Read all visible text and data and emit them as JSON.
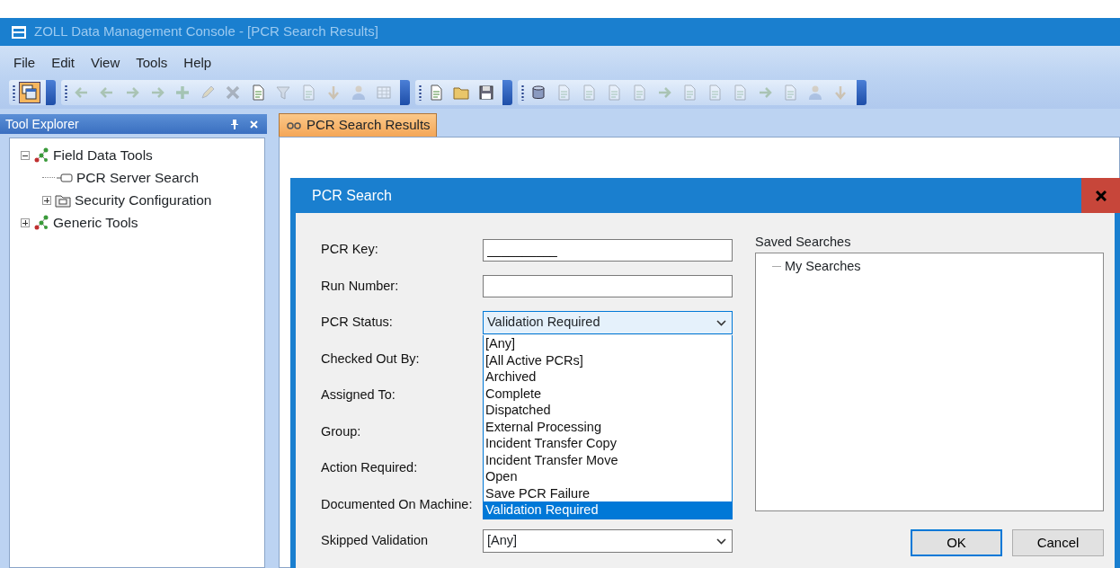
{
  "window": {
    "title": "ZOLL Data Management Console - [PCR Search Results]",
    "active": false
  },
  "menu": [
    {
      "label": "File"
    },
    {
      "label": "Edit"
    },
    {
      "label": "View"
    },
    {
      "label": "Tools"
    },
    {
      "label": "Help"
    }
  ],
  "toolbars": [
    {
      "items": [
        {
          "kind": "windows",
          "disabled": false,
          "selected": true
        }
      ]
    },
    {
      "items": [
        {
          "kind": "arrow-left",
          "disabled": true,
          "selected": false
        },
        {
          "kind": "arrow-left",
          "disabled": true,
          "selected": false
        },
        {
          "kind": "arrow-right",
          "disabled": true,
          "selected": false
        },
        {
          "kind": "arrow-right",
          "disabled": true,
          "selected": false
        },
        {
          "kind": "plus",
          "disabled": true,
          "selected": false
        },
        {
          "kind": "pencil",
          "disabled": true,
          "selected": false
        },
        {
          "kind": "cross",
          "disabled": true,
          "selected": false
        },
        {
          "kind": "page",
          "disabled": false,
          "selected": false
        },
        {
          "kind": "funnel",
          "disabled": true,
          "selected": false
        },
        {
          "kind": "page",
          "disabled": true,
          "selected": false
        },
        {
          "kind": "arrow-down",
          "disabled": true,
          "selected": false
        },
        {
          "kind": "person",
          "disabled": true,
          "selected": false
        },
        {
          "kind": "grid",
          "disabled": true,
          "selected": false
        }
      ]
    },
    {
      "items": [
        {
          "kind": "page",
          "disabled": false,
          "selected": false
        },
        {
          "kind": "folder",
          "disabled": false,
          "selected": false
        },
        {
          "kind": "disk",
          "disabled": false,
          "selected": false
        }
      ]
    },
    {
      "items": [
        {
          "kind": "cylinder",
          "disabled": false,
          "selected": false
        },
        {
          "kind": "page",
          "disabled": true,
          "selected": false
        },
        {
          "kind": "page",
          "disabled": true,
          "selected": false
        },
        {
          "kind": "page",
          "disabled": true,
          "selected": false
        },
        {
          "kind": "page",
          "disabled": true,
          "selected": false
        },
        {
          "kind": "arrow-right",
          "disabled": true,
          "selected": false
        },
        {
          "kind": "page",
          "disabled": true,
          "selected": false
        },
        {
          "kind": "page",
          "disabled": true,
          "selected": false
        },
        {
          "kind": "page",
          "disabled": true,
          "selected": false
        },
        {
          "kind": "arrow-right",
          "disabled": true,
          "selected": false
        },
        {
          "kind": "page",
          "disabled": true,
          "selected": false
        },
        {
          "kind": "person",
          "disabled": true,
          "selected": false
        },
        {
          "kind": "arrow-down",
          "disabled": true,
          "selected": false
        }
      ]
    }
  ],
  "tool_explorer": {
    "title": "Tool Explorer",
    "tree": [
      {
        "label": "Field Data Tools",
        "kind": "network",
        "expanded": true,
        "children": [
          {
            "label": "PCR Server Search",
            "kind": "form"
          },
          {
            "label": "Security Configuration",
            "kind": "folder",
            "expanded": false
          }
        ]
      },
      {
        "label": "Generic Tools",
        "kind": "network",
        "expanded": false
      }
    ]
  },
  "tabs": [
    {
      "label": "PCR Search Results",
      "selected": true
    }
  ],
  "dialog": {
    "title": "PCR Search",
    "fields": [
      {
        "label": "PCR Key:",
        "kind": "text",
        "value": "__________"
      },
      {
        "label": "Run Number:",
        "kind": "text"
      },
      {
        "label": "PCR Status:",
        "kind": "combo",
        "value": "Validation Required",
        "open": true,
        "options": [
          {
            "label": "[Any]",
            "selected": false
          },
          {
            "label": "[All Active PCRs]",
            "selected": false
          },
          {
            "label": "Archived",
            "selected": false
          },
          {
            "label": "Complete",
            "selected": false
          },
          {
            "label": "Dispatched",
            "selected": false
          },
          {
            "label": "External Processing",
            "selected": false
          },
          {
            "label": "Incident Transfer Copy",
            "selected": false
          },
          {
            "label": "Incident Transfer Move",
            "selected": false
          },
          {
            "label": "Open",
            "selected": false
          },
          {
            "label": "Save PCR Failure",
            "selected": false
          },
          {
            "label": "Validation Required",
            "selected": true
          }
        ]
      },
      {
        "label": "Checked Out By:"
      },
      {
        "label": "Assigned To:"
      },
      {
        "label": "Group:"
      },
      {
        "label": "Action Required:"
      },
      {
        "label": "Documented On Machine:"
      },
      {
        "label": "Skipped Validation",
        "kind": "combo",
        "value": "[Any]",
        "open": false
      }
    ],
    "saved_searches": {
      "label": "Saved Searches",
      "tree": [
        {
          "label": "My Searches"
        }
      ]
    },
    "buttons": [
      {
        "label": "OK",
        "default": true
      },
      {
        "label": "Cancel",
        "default": false
      }
    ]
  }
}
